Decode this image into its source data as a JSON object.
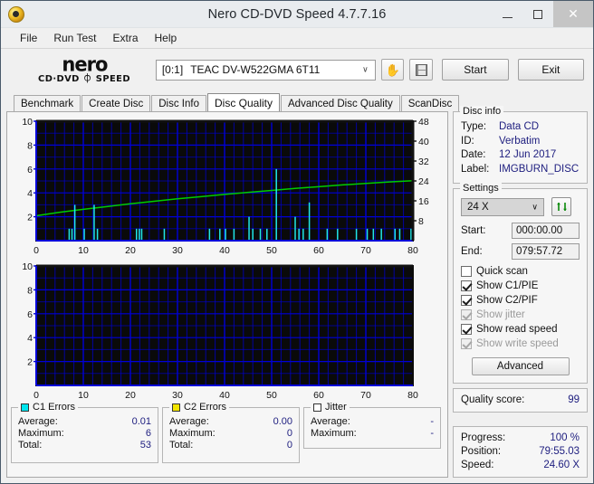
{
  "window": {
    "title": "Nero CD-DVD Speed 4.7.7.16",
    "icon": "nero-app-icon",
    "minimize": "minimize-icon",
    "maximize": "maximize-icon",
    "close": "✕"
  },
  "menu": {
    "items": [
      "File",
      "Run Test",
      "Extra",
      "Help"
    ]
  },
  "toolbar": {
    "logo_word": "nero",
    "logo_sub": "CD·DVD ⏀ SPEED",
    "drive_bay": "[0:1]",
    "drive_name": "TEAC DV-W522GMA 6T11",
    "dropdown_arrow": "∨",
    "eject_icon": "hand-eject-icon",
    "save_icon": "floppy-save-icon",
    "start_label": "Start",
    "exit_label": "Exit"
  },
  "tabs": {
    "items": [
      "Benchmark",
      "Create Disc",
      "Disc Info",
      "Disc Quality",
      "Advanced Disc Quality",
      "ScanDisc"
    ],
    "active": "Disc Quality"
  },
  "disc_info": {
    "legend": "Disc info",
    "rows": [
      {
        "key": "Type:",
        "value": "Data CD"
      },
      {
        "key": "ID:",
        "value": "Verbatim"
      },
      {
        "key": "Date:",
        "value": "12 Jun 2017"
      },
      {
        "key": "Label:",
        "value": "IMGBURN_DISC"
      }
    ]
  },
  "settings": {
    "legend": "Settings",
    "speed_value": "24 X",
    "speed_arrow": "∨",
    "refresh_icon": "refresh-icon",
    "start_label": "Start:",
    "start_value": "000:00.00",
    "end_label": "End:",
    "end_value": "079:57.72",
    "checks": [
      {
        "label": "Quick scan",
        "checked": false,
        "disabled": false
      },
      {
        "label": "Show C1/PIE",
        "checked": true,
        "disabled": false
      },
      {
        "label": "Show C2/PIF",
        "checked": true,
        "disabled": false
      },
      {
        "label": "Show jitter",
        "checked": true,
        "disabled": true
      },
      {
        "label": "Show read speed",
        "checked": true,
        "disabled": false
      },
      {
        "label": "Show write speed",
        "checked": true,
        "disabled": true
      }
    ],
    "advanced_label": "Advanced"
  },
  "quality": {
    "label": "Quality score:",
    "value": "99"
  },
  "progress": {
    "rows": [
      {
        "key": "Progress:",
        "value": "100 %"
      },
      {
        "key": "Position:",
        "value": "79:55.03"
      },
      {
        "key": "Speed:",
        "value": "24.60 X"
      }
    ]
  },
  "stats": {
    "c1": {
      "legend": "C1 Errors",
      "swatch": "#00e5ee",
      "rows": [
        {
          "key": "Average:",
          "value": "0.01"
        },
        {
          "key": "Maximum:",
          "value": "6"
        },
        {
          "key": "Total:",
          "value": "53"
        }
      ]
    },
    "c2": {
      "legend": "C2 Errors",
      "swatch": "#f2e500",
      "rows": [
        {
          "key": "Average:",
          "value": "0.00"
        },
        {
          "key": "Maximum:",
          "value": "0"
        },
        {
          "key": "Total:",
          "value": "0"
        }
      ]
    },
    "jitter": {
      "legend": "Jitter",
      "swatch": "#ffffff",
      "rows": [
        {
          "key": "Average:",
          "value": "-"
        },
        {
          "key": "Maximum:",
          "value": "-"
        }
      ]
    }
  },
  "chart_data": [
    {
      "id": "c1-chart",
      "type": "line",
      "title": "C1 Errors / Read speed vs disc position",
      "xlabel": "",
      "ylabel": "",
      "xlim": [
        0,
        80
      ],
      "xticks": [
        0,
        10,
        20,
        30,
        40,
        50,
        60,
        70,
        80
      ],
      "ylim": [
        0,
        10
      ],
      "yticks": [
        2,
        4,
        6,
        8,
        10
      ],
      "y2lim": [
        0,
        48
      ],
      "y2ticks": [
        8,
        16,
        24,
        32,
        40,
        48
      ],
      "grid": true,
      "background": "#0a0a0a",
      "gridcolor": "#0000d8",
      "series": [
        {
          "name": "Read speed",
          "axis": "right",
          "color": "#00cc00",
          "type": "line",
          "x": [
            0,
            5,
            10,
            15,
            20,
            25,
            30,
            35,
            40,
            45,
            50,
            55,
            60,
            65,
            70,
            75,
            80
          ],
          "values": [
            10.0,
            11.4,
            12.6,
            13.7,
            14.8,
            15.8,
            16.8,
            17.7,
            18.6,
            19.4,
            20.2,
            21.0,
            21.7,
            22.4,
            23.0,
            23.6,
            24.1
          ]
        },
        {
          "name": "C1 Errors",
          "axis": "left",
          "color": "#20e8e8",
          "type": "bar",
          "points": [
            {
              "x": 7.0,
              "y": 1.0
            },
            {
              "x": 7.6,
              "y": 1.0
            },
            {
              "x": 8.2,
              "y": 3.0
            },
            {
              "x": 10.2,
              "y": 1.0
            },
            {
              "x": 12.3,
              "y": 3.0
            },
            {
              "x": 13.0,
              "y": 1.0
            },
            {
              "x": 21.3,
              "y": 1.0
            },
            {
              "x": 21.9,
              "y": 1.0
            },
            {
              "x": 22.4,
              "y": 1.0
            },
            {
              "x": 27.2,
              "y": 1.0
            },
            {
              "x": 36.8,
              "y": 1.0
            },
            {
              "x": 39.0,
              "y": 1.0
            },
            {
              "x": 40.2,
              "y": 1.0
            },
            {
              "x": 42.0,
              "y": 1.0
            },
            {
              "x": 45.2,
              "y": 2.0
            },
            {
              "x": 46.0,
              "y": 1.0
            },
            {
              "x": 47.6,
              "y": 1.0
            },
            {
              "x": 49.0,
              "y": 1.0
            },
            {
              "x": 51.0,
              "y": 6.0
            },
            {
              "x": 55.0,
              "y": 2.0
            },
            {
              "x": 55.8,
              "y": 1.0
            },
            {
              "x": 56.7,
              "y": 1.0
            },
            {
              "x": 58.0,
              "y": 3.2
            },
            {
              "x": 61.8,
              "y": 1.0
            },
            {
              "x": 64.0,
              "y": 1.0
            },
            {
              "x": 68.0,
              "y": 1.0
            },
            {
              "x": 70.3,
              "y": 1.0
            },
            {
              "x": 71.6,
              "y": 1.0
            },
            {
              "x": 73.3,
              "y": 1.0
            },
            {
              "x": 76.2,
              "y": 1.0
            },
            {
              "x": 77.2,
              "y": 1.0
            },
            {
              "x": 79.6,
              "y": 1.0
            }
          ]
        }
      ]
    },
    {
      "id": "c2-chart",
      "type": "line",
      "title": "C2 Errors vs disc position",
      "xlabel": "",
      "ylabel": "",
      "xlim": [
        0,
        80
      ],
      "xticks": [
        0,
        10,
        20,
        30,
        40,
        50,
        60,
        70,
        80
      ],
      "ylim": [
        0,
        10
      ],
      "yticks": [
        2,
        4,
        6,
        8,
        10
      ],
      "grid": true,
      "background": "#0a0a0a",
      "gridcolor": "#0000d8",
      "series": [
        {
          "name": "C2 Errors",
          "axis": "left",
          "color": "#f2e500",
          "type": "bar",
          "points": []
        }
      ]
    }
  ]
}
